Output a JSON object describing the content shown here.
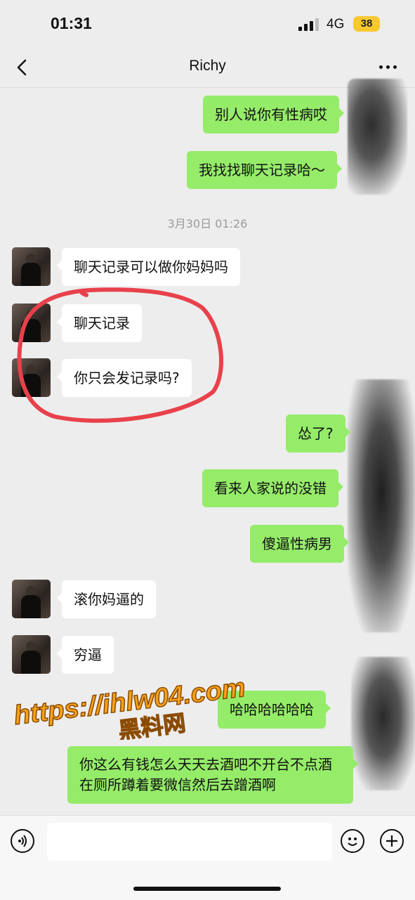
{
  "status": {
    "time": "01:31",
    "network": "4G",
    "battery": "38"
  },
  "header": {
    "title": "Richy",
    "back_icon": "chevron-left-icon",
    "more_icon": "ellipsis-icon"
  },
  "timestamp": "3月30日 01:26",
  "messages": [
    {
      "side": "out",
      "text": "别人说你有性病哎"
    },
    {
      "side": "out",
      "text": "我找找聊天记录哈～"
    },
    {
      "side": "in",
      "text": "聊天记录可以做你妈妈吗"
    },
    {
      "side": "in",
      "text": "聊天记录"
    },
    {
      "side": "in",
      "text": "你只会发记录吗?"
    },
    {
      "side": "out",
      "text": "怂了?"
    },
    {
      "side": "out",
      "text": "看来人家说的没错"
    },
    {
      "side": "out",
      "text": "傻逼性病男"
    },
    {
      "side": "in",
      "text": "滚你妈逼的"
    },
    {
      "side": "in",
      "text": "穷逼"
    },
    {
      "side": "out",
      "text": "哈哈哈哈哈哈"
    },
    {
      "side": "out",
      "text": "你这么有钱怎么天天去酒吧不开台不点酒  在厕所蹲着要微信然后去蹭酒啊"
    }
  ],
  "watermark": {
    "url": "https://ihlw04.com",
    "name": "黑料网"
  },
  "input": {
    "placeholder": "",
    "voice_icon": "voice-icon",
    "emoji_icon": "emoji-icon",
    "plus_icon": "plus-icon"
  },
  "colors": {
    "outgoing": "#95ec69",
    "incoming": "#ffffff",
    "background": "#ededed",
    "annotation": "#e8414b",
    "watermark": "#f7a21b"
  }
}
